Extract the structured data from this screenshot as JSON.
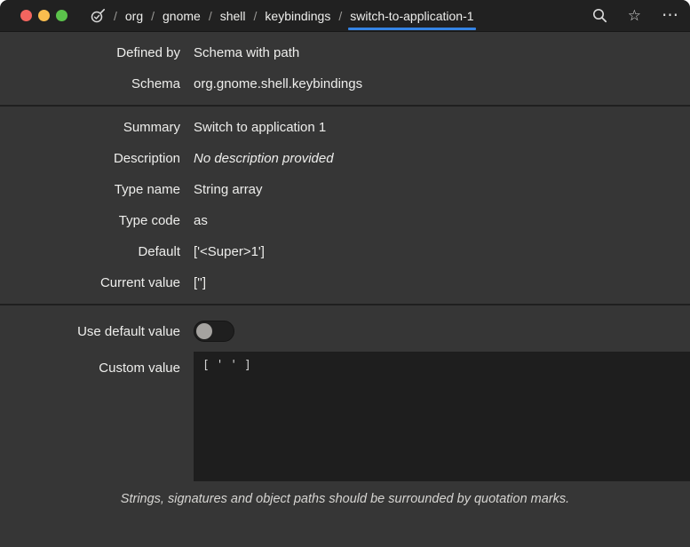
{
  "colors": {
    "accent": "#3584e4",
    "close_button": "#f4655f",
    "minimize_button": "#f9bd4e",
    "maximize_button": "#5bc24b",
    "header_bg": "#212121",
    "window_bg": "#363636",
    "textarea_bg": "#1e1e1e"
  },
  "header": {
    "breadcrumb": {
      "separator": "/",
      "items": [
        "org",
        "gnome",
        "shell",
        "keybindings",
        "switch-to-application-1"
      ]
    },
    "icons": {
      "app": "dconf-editor-app-icon",
      "search": "search-icon",
      "bookmark": "star-icon",
      "menu": "menu-icon",
      "bookmark_glyph": "☆",
      "menu_glyph": "⋯"
    }
  },
  "properties": {
    "origin_rows": [
      {
        "label": "Defined by",
        "value": "Schema with path"
      },
      {
        "label": "Schema",
        "value": "org.gnome.shell.keybindings"
      }
    ],
    "detail_rows": [
      {
        "label": "Summary",
        "value": "Switch to application 1"
      },
      {
        "label": "Description",
        "value": "No description provided"
      },
      {
        "label": "Type name",
        "value": "String array"
      },
      {
        "label": "Type code",
        "value": "as"
      },
      {
        "label": "Default",
        "value": "['<Super>1']"
      },
      {
        "label": "Current value",
        "value": "['']"
      }
    ]
  },
  "editor": {
    "use_default": {
      "label": "Use default value",
      "state": "off"
    },
    "custom_value": {
      "label": "Custom value",
      "text": "[ ' ' ]"
    }
  },
  "footer": {
    "note": "Strings, signatures and object paths should be surrounded by quotation marks."
  }
}
